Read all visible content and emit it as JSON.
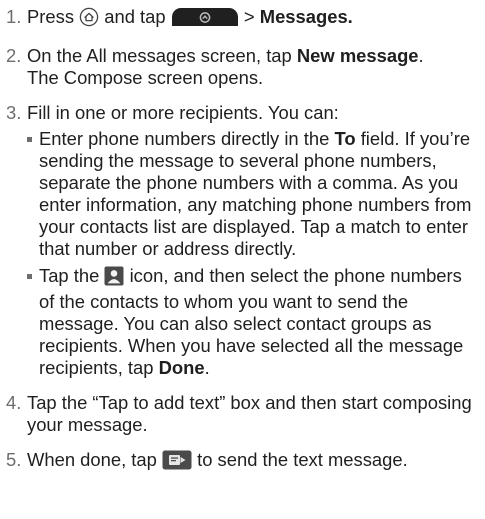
{
  "steps": [
    {
      "num": "1.",
      "press": "Press",
      "home_icon": "home-button-icon",
      "and_tap": "and tap",
      "apps_icon": "all-apps-button-icon",
      "sep": ">",
      "target": "Messages."
    },
    {
      "num": "2.",
      "lead": "On the All messages screen, tap",
      "bold": "New message",
      "tail": ".",
      "line2": "The Compose screen opens."
    },
    {
      "num": "3.",
      "text": "Fill in one or more recipients. You can:",
      "bullets": [
        {
          "pre": "Enter phone numbers directly in the",
          "bold": "To",
          "post": "field. If you’re sending the message to several phone numbers, separate the phone numbers with a comma. As you enter information, any matching phone numbers from your contacts list are displayed. Tap a match to enter that number or address directly."
        },
        {
          "pre": "Tap the",
          "icon": "contact-person-icon",
          "mid": "icon, and then select the phone numbers of the contacts to whom you want to send the message. You can also select contact groups as recipients. When you have selected all the message recipients, tap",
          "bold": "Done",
          "post": "."
        }
      ]
    },
    {
      "num": "4.",
      "text": "Tap the “Tap to add text” box and then start composing your message."
    },
    {
      "num": "5.",
      "pre": "When done, tap",
      "icon": "send-message-icon",
      "post": "to send the text message."
    }
  ],
  "colors": {
    "text": "#1f1f1f",
    "number": "#6e6e6e",
    "icon_bg": "#4a4a4a"
  }
}
